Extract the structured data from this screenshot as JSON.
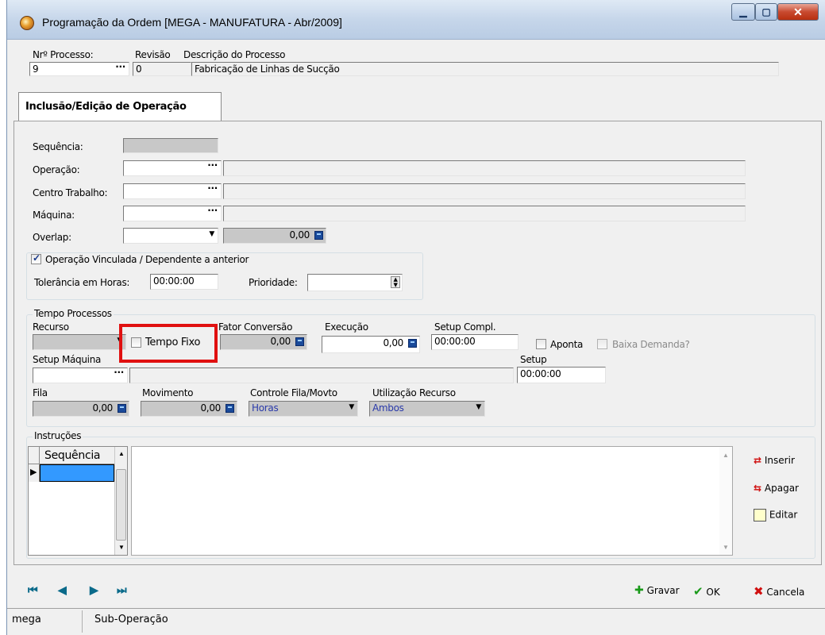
{
  "window": {
    "title": "Programação da Ordem [MEGA - MANUFATURA - Abr/2009]",
    "minimize": "▁",
    "maximize": "▢",
    "close": "✕"
  },
  "header": {
    "process_no_label": "Nrº Processo:",
    "process_no_value": "9",
    "revision_label": "Revisão",
    "revision_value": "0",
    "description_label": "Descrição do Processo",
    "description_value": "Fabricação de Linhas de Sucção"
  },
  "tab": {
    "label": "Inclusão/Edição de Operação"
  },
  "form": {
    "sequencia_label": "Sequência:",
    "operacao_label": "Operação:",
    "centro_label": "Centro Trabalho:",
    "maquina_label": "Máquina:",
    "overlap_label": "Overlap:",
    "overlap_value": "0,00",
    "vinculada_label": "Operação Vinculada / Dependente a anterior",
    "vinculada_checked": true,
    "tolerancia_label": "Tolerância em Horas:",
    "tolerancia_value": "00:00:00",
    "prioridade_label": "Prioridade:"
  },
  "tempo": {
    "group_label": "Tempo Processos",
    "recurso_label": "Recurso",
    "tempo_fixo_label": "Tempo Fixo",
    "fator_label": "Fator Conversão",
    "fator_value": "0,00",
    "execucao_label": "Execução",
    "execucao_value": "0,00",
    "setup_compl_label": "Setup Compl.",
    "setup_compl_value": "00:00:00",
    "aponta_label": "Aponta",
    "baixa_label": "Baixa Demanda?",
    "setup_maquina_label": "Setup Máquina",
    "setup_label": "Setup",
    "setup_value": "00:00:00",
    "fila_label": "Fila",
    "fila_value": "0,00",
    "movimento_label": "Movimento",
    "movimento_value": "0,00",
    "controle_label": "Controle Fila/Movto",
    "controle_value": "Horas",
    "utilizacao_label": "Utilização Recurso",
    "utilizacao_value": "Ambos"
  },
  "instrucoes": {
    "group_label": "Instruções",
    "col_header": "Sequência",
    "inserir": "Inserir",
    "apagar": "Apagar",
    "editar": "Editar"
  },
  "nav": {
    "first": "⏮",
    "prev": "◀",
    "next": "▶",
    "last": "⏭"
  },
  "actions": {
    "gravar": "Gravar",
    "ok": "OK",
    "cancela": "Cancela"
  },
  "status": {
    "user": "mega",
    "context": "Sub-Operação"
  },
  "colors": {
    "highlight": "#e01010",
    "selected_row": "#3399ff"
  }
}
